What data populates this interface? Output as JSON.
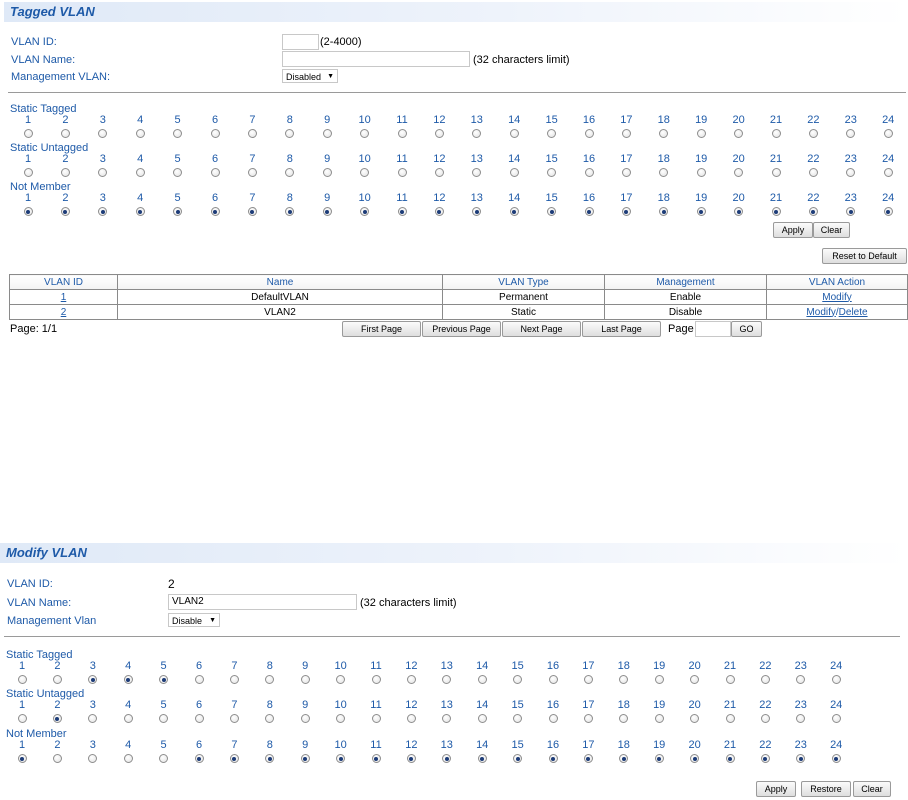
{
  "tagged_vlan": {
    "title": "Tagged VLAN",
    "vlan_id_label": "VLAN ID:",
    "vlan_id_value": "",
    "vlan_id_hint": "(2-4000)",
    "vlan_name_label": "VLAN Name:",
    "vlan_name_value": "",
    "vlan_name_hint": "(32 characters limit)",
    "mgmt_label": "Management VLAN:",
    "mgmt_value": "Disabled",
    "groups": [
      {
        "label": "Static Tagged",
        "selected": []
      },
      {
        "label": "Static Untagged",
        "selected": []
      },
      {
        "label": "Not Member",
        "selected": [
          1,
          2,
          3,
          4,
          5,
          6,
          7,
          8,
          9,
          10,
          11,
          12,
          13,
          14,
          15,
          16,
          17,
          18,
          19,
          20,
          21,
          22,
          23,
          24
        ]
      }
    ],
    "apply_label": "Apply",
    "clear_label": "Clear",
    "reset_label": "Reset to Default"
  },
  "ports": [
    "1",
    "2",
    "3",
    "4",
    "5",
    "6",
    "7",
    "8",
    "9",
    "10",
    "11",
    "12",
    "13",
    "14",
    "15",
    "16",
    "17",
    "18",
    "19",
    "20",
    "21",
    "22",
    "23",
    "24"
  ],
  "table": {
    "headers": [
      "VLAN ID",
      "Name",
      "VLAN Type",
      "Management",
      "VLAN Action"
    ],
    "rows": [
      {
        "id": "1",
        "name": "DefaultVLAN",
        "type": "Permanent",
        "management": "Enable",
        "action_modify": "Modify",
        "action_delete": ""
      },
      {
        "id": "2",
        "name": "VLAN2",
        "type": "Static",
        "management": "Disable",
        "action_modify": "Modify",
        "action_sep": "/",
        "action_delete": "Delete"
      }
    ]
  },
  "pager": {
    "page_info": "Page:  1/1",
    "first": "First Page",
    "previous": "Previous Page",
    "next": "Next Page",
    "last": "Last Page",
    "page_label": "Page",
    "page_value": "",
    "go": "GO"
  },
  "modify_vlan": {
    "title": "Modify VLAN",
    "vlan_id_label": "VLAN ID:",
    "vlan_id_value": "2",
    "vlan_name_label": "VLAN Name:",
    "vlan_name_value": "VLAN2",
    "vlan_name_hint": "(32 characters limit)",
    "mgmt_label": "Management Vlan",
    "mgmt_value": "Disable",
    "groups": [
      {
        "label": "Static Tagged",
        "selected": [
          3,
          4,
          5
        ]
      },
      {
        "label": "Static Untagged",
        "selected": [
          2
        ]
      },
      {
        "label": "Not Member",
        "selected": [
          1,
          6,
          7,
          8,
          9,
          10,
          11,
          12,
          13,
          14,
          15,
          16,
          17,
          18,
          19,
          20,
          21,
          22,
          23,
          24
        ]
      }
    ],
    "apply_label": "Apply",
    "restore_label": "Restore",
    "clear_label": "Clear"
  }
}
